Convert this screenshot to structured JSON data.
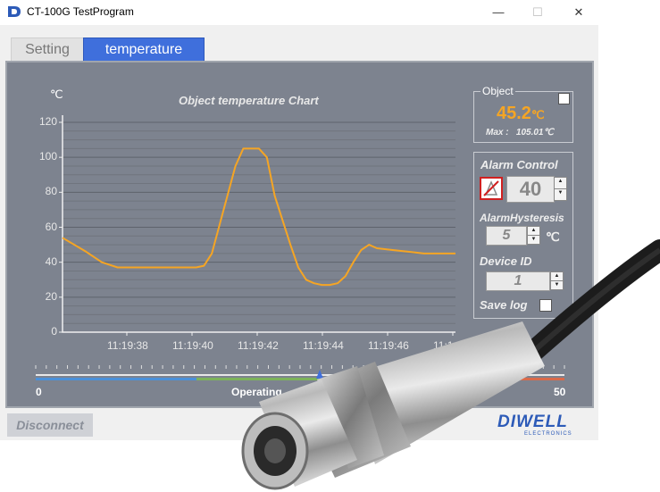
{
  "window": {
    "title": "CT-100G TestProgram",
    "minimize": "—",
    "maximize": "☐",
    "close": "✕"
  },
  "tabs": [
    {
      "label": "Setting",
      "active": false
    },
    {
      "label": "temperature",
      "active": true
    }
  ],
  "chart": {
    "unit": "℃",
    "title": "Object temperature Chart"
  },
  "chart_data": {
    "type": "line",
    "title": "Object temperature Chart",
    "ylabel": "℃",
    "xlabel": "",
    "ylim": [
      0,
      120
    ],
    "yticks": [
      0,
      20,
      40,
      60,
      80,
      100,
      120
    ],
    "xtick_labels": [
      "11:19:38",
      "11:19:40",
      "11:19:42",
      "11:19:44",
      "11:19:46",
      "11:1"
    ],
    "grid": true,
    "series": [
      {
        "color": "#f5a524",
        "x": [
          0,
          0.06,
          0.1,
          0.14,
          0.2,
          0.26,
          0.3,
          0.34,
          0.36,
          0.38,
          0.41,
          0.44,
          0.46,
          0.48,
          0.49,
          0.5,
          0.52,
          0.54,
          0.58,
          0.6,
          0.62,
          0.64,
          0.66,
          0.68,
          0.7,
          0.72,
          0.74,
          0.76,
          0.78,
          0.8,
          0.84,
          0.88,
          0.92,
          0.96,
          1
        ],
        "y": [
          54,
          46,
          40,
          37,
          37,
          37,
          37,
          37,
          38,
          45,
          70,
          95,
          105,
          105,
          105,
          105,
          100,
          78,
          50,
          37,
          30,
          28,
          27,
          27,
          28,
          32,
          40,
          47,
          50,
          48,
          47,
          46,
          45,
          45,
          45
        ]
      }
    ]
  },
  "object_panel": {
    "title": "Object",
    "temperature": "45.2",
    "unit": "℃",
    "max_label": "Max :",
    "max_value": "105.01℃"
  },
  "alarm": {
    "title": "Alarm Control",
    "value": "40",
    "hysteresis_label": "AlarmHysteresis",
    "hysteresis_value": "5",
    "hysteresis_unit": "℃",
    "device_id_label": "Device ID",
    "device_id_value": "1",
    "save_log_label": "Save log"
  },
  "slider": {
    "min": "0",
    "max": "50",
    "label": "Operating"
  },
  "buttons": {
    "disconnect": "Disconnect"
  },
  "logo": {
    "main": "DIWELL",
    "sub": "ELECTRONICS"
  },
  "colors": {
    "panel": "#7d838f",
    "active_tab": "#3f6fdc",
    "series": "#f5a524",
    "object_value": "#f5a524",
    "logo": "#2d5bb8",
    "alarm_icon_border": "#d02020"
  }
}
